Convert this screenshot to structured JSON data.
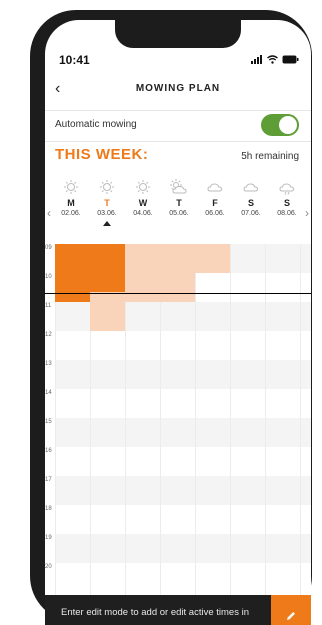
{
  "status": {
    "time": "10:41"
  },
  "header": {
    "back_glyph": "‹",
    "title": "MOWING PLAN"
  },
  "automatic": {
    "label": "Automatic mowing",
    "enabled": true
  },
  "week": {
    "title": "THIS WEEK:",
    "remaining": "5h remaining"
  },
  "nav": {
    "prev": "‹",
    "next": "›"
  },
  "days": [
    {
      "letter": "M",
      "date": "02.06.",
      "weather": "sun-icon",
      "today": false
    },
    {
      "letter": "T",
      "date": "03.06.",
      "weather": "sun-icon",
      "today": true
    },
    {
      "letter": "W",
      "date": "04.06.",
      "weather": "sun-icon",
      "today": false
    },
    {
      "letter": "T",
      "date": "05.06.",
      "weather": "partly-cloudy-icon",
      "today": false
    },
    {
      "letter": "F",
      "date": "06.06.",
      "weather": "cloud-icon",
      "today": false
    },
    {
      "letter": "S",
      "date": "07.06.",
      "weather": "cloud-icon",
      "today": false
    },
    {
      "letter": "S",
      "date": "08.06.",
      "weather": "rain-cloud-icon",
      "today": false
    }
  ],
  "hours": [
    "09",
    "10",
    "11",
    "12",
    "13",
    "14",
    "15",
    "16",
    "17",
    "18",
    "19",
    "20"
  ],
  "mowing_blocks": [
    {
      "day": 0,
      "start": 9.0,
      "end": 11.0,
      "status": "active"
    },
    {
      "day": 1,
      "start": 9.0,
      "end": 10.65,
      "status": "active"
    },
    {
      "day": 1,
      "start": 10.65,
      "end": 12.0,
      "status": "planned"
    },
    {
      "day": 2,
      "start": 9.0,
      "end": 11.0,
      "status": "planned"
    },
    {
      "day": 3,
      "start": 9.0,
      "end": 11.0,
      "status": "planned"
    },
    {
      "day": 4,
      "start": 9.0,
      "end": 10.0,
      "status": "planned"
    }
  ],
  "current_time": 10.68,
  "bottom": {
    "hint": "Enter edit mode to add or edit active times in the mowing plan"
  },
  "colors": {
    "accent": "#ee7a1a",
    "active": "#ee7a1a",
    "planned": "#f9d4bb",
    "toggle_on": "#5f9e36",
    "band": "#f4f4f4"
  }
}
